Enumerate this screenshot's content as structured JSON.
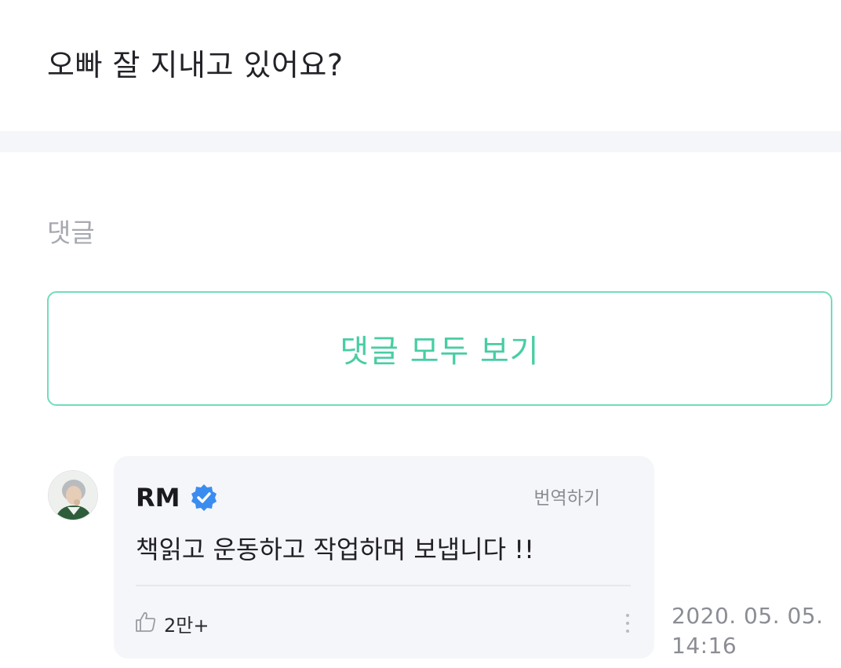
{
  "post": {
    "text": "오빠 잘 지내고 있어요?"
  },
  "comments_section": {
    "title": "댓글",
    "view_all_label": "댓글 모두 보기"
  },
  "comment": {
    "author": "RM",
    "verified_icon": "verified-badge-icon",
    "translate_label": "번역하기",
    "body": "책읽고 운동하고 작업하며 보냅니다 !!",
    "like_count": "2만+",
    "date_line": "2020. 05. 05.",
    "time_line": "14:16"
  },
  "colors": {
    "accent": "#48cda4",
    "accent_border": "#72dcbc",
    "verified": "#3b8cf0",
    "bubble_bg": "#f5f6f9",
    "muted_text": "#8b8d94"
  }
}
